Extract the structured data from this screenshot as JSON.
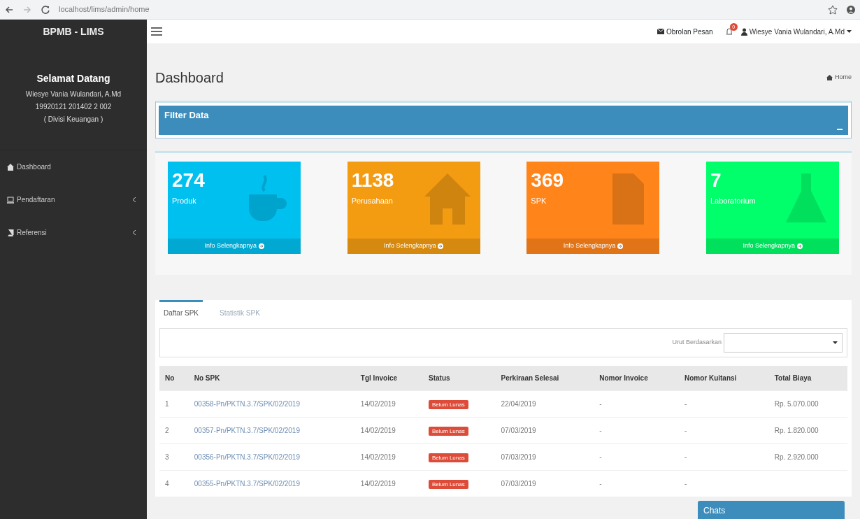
{
  "browser": {
    "address": "localhost/lims/admin/home"
  },
  "sidebar": {
    "brand": "BPMB - LIMS",
    "welcome": "Selamat Datang",
    "user_name": "Wiesye Vania Wulandari, A.Md",
    "user_id": "19920121 201402 2 002",
    "division": "( Divisi Keuangan )",
    "items": [
      {
        "label": "Dashboard",
        "expandable": false
      },
      {
        "label": "Pendaftaran",
        "expandable": true
      },
      {
        "label": "Referensi",
        "expandable": true
      }
    ]
  },
  "navbar": {
    "messages": "Obrolan Pesan",
    "notification_count": "0",
    "user": "Wiesye Vania Wulandari, A.Md"
  },
  "page": {
    "title": "Dashboard",
    "breadcrumb": "Home"
  },
  "filter": {
    "title": "Filter Data"
  },
  "stats": [
    {
      "value": "274",
      "label": "Produk",
      "footer": "Info Selengkapnya",
      "color": "#00c0ef"
    },
    {
      "value": "1138",
      "label": "Perusahaan",
      "footer": "Info Selengkapnya",
      "color": "#f39c12"
    },
    {
      "value": "369",
      "label": "SPK",
      "footer": "Info Selengkapnya",
      "color": "#ff851b"
    },
    {
      "value": "7",
      "label": "Laboratorium",
      "footer": "Info Selengkapnya",
      "color": "#00ff6a"
    }
  ],
  "tabs": [
    {
      "label": "Daftar SPK",
      "selected": true
    },
    {
      "label": "Statistik SPK",
      "selected": false
    }
  ],
  "sort": {
    "label": "Urut Berdasarkan"
  },
  "table": {
    "columns": [
      "No",
      "No SPK",
      "Tgl Invoice",
      "Status",
      "Perkiraan Selesai",
      "Nomor Invoice",
      "Nomor Kuitansi",
      "Total Biaya"
    ],
    "rows": [
      [
        "1",
        "00358-Pn/PKTN.3.7/SPK/02/2019",
        "14/02/2019",
        "Belum Lunas",
        "22/04/2019",
        "-",
        "-",
        "Rp. 5.070.000"
      ],
      [
        "2",
        "00357-Pn/PKTN.3.7/SPK/02/2019",
        "14/02/2019",
        "Belum Lunas",
        "07/03/2019",
        "-",
        "-",
        "Rp. 1.820.000"
      ],
      [
        "3",
        "00356-Pn/PKTN.3.7/SPK/02/2019",
        "14/02/2019",
        "Belum Lunas",
        "07/03/2019",
        "-",
        "-",
        "Rp. 2.920.000"
      ],
      [
        "4",
        "00355-Pn/PKTN.3.7/SPK/02/2019",
        "14/02/2019",
        "Belum Lunas",
        "07/03/2019",
        "-",
        "-",
        null
      ]
    ]
  },
  "chat": {
    "title": "Chats"
  }
}
